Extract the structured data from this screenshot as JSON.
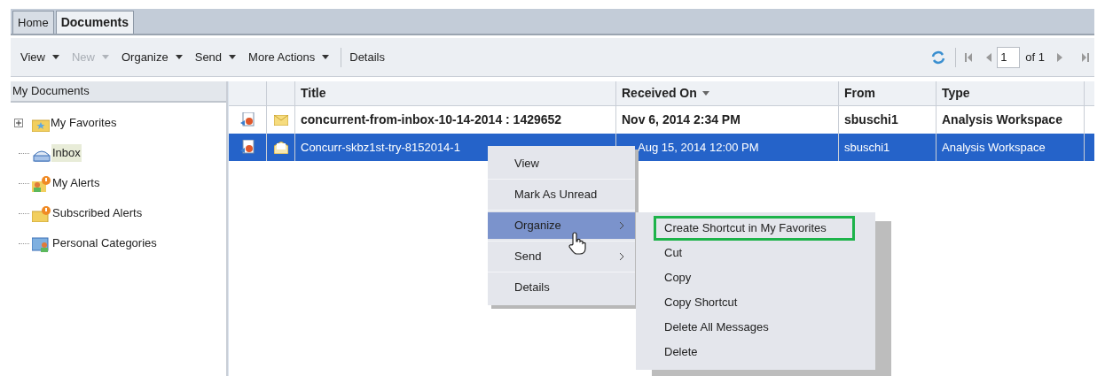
{
  "tabs": [
    {
      "label": "Home",
      "selected": false
    },
    {
      "label": "Documents",
      "selected": true
    }
  ],
  "toolbar": {
    "items": [
      {
        "label": "View",
        "disabled": false,
        "dropdown": true
      },
      {
        "label": "New",
        "disabled": true,
        "dropdown": true
      },
      {
        "label": "Organize",
        "disabled": false,
        "dropdown": true
      },
      {
        "label": "Send",
        "disabled": false,
        "dropdown": true
      },
      {
        "label": "More Actions",
        "disabled": false,
        "dropdown": true
      },
      {
        "label": "Details",
        "disabled": false,
        "dropdown": false
      }
    ],
    "page": "1",
    "page_of": "of 1"
  },
  "sidebar": {
    "title": "My Documents",
    "items": [
      {
        "label": "My Favorites",
        "selected": false,
        "kind": "favorites",
        "expandable": true
      },
      {
        "label": "Inbox",
        "selected": true,
        "kind": "inbox",
        "expandable": false
      },
      {
        "label": "My Alerts",
        "selected": false,
        "kind": "alerts",
        "expandable": false
      },
      {
        "label": "Subscribed Alerts",
        "selected": false,
        "kind": "subscribed",
        "expandable": false
      },
      {
        "label": "Personal Categories",
        "selected": false,
        "kind": "categories",
        "expandable": false
      }
    ]
  },
  "table": {
    "columns": [
      "Title",
      "Received On",
      "From",
      "Type"
    ],
    "rows": [
      {
        "title": "concurrent-from-inbox-10-14-2014 : 1429652",
        "received": "Nov 6, 2014 2:34 PM",
        "from": "sbuschi1",
        "type": "Analysis Workspace",
        "unread": true,
        "selected": false
      },
      {
        "title": "Concurr-skbz1st-try-8152014-1",
        "received": "Aug 15, 2014 12:00 PM",
        "from": "sbuschi1",
        "type": "Analysis Workspace",
        "unread": false,
        "selected": true
      }
    ]
  },
  "context_menu": [
    {
      "label": "View",
      "selected": false,
      "submenu": false
    },
    {
      "label": "Mark As Unread",
      "selected": false,
      "submenu": false
    },
    {
      "label": "Organize",
      "selected": true,
      "submenu": true
    },
    {
      "label": "Send",
      "selected": false,
      "submenu": true
    },
    {
      "label": "Details",
      "selected": false,
      "submenu": false
    }
  ],
  "submenu": [
    {
      "label": "Create Shortcut in My Favorites",
      "highlighted": true
    },
    {
      "label": "Cut",
      "highlighted": false
    },
    {
      "label": "Copy",
      "highlighted": false
    },
    {
      "label": "Copy Shortcut",
      "highlighted": false
    },
    {
      "label": "Delete All Messages",
      "highlighted": false
    },
    {
      "label": "Delete",
      "highlighted": false
    }
  ]
}
